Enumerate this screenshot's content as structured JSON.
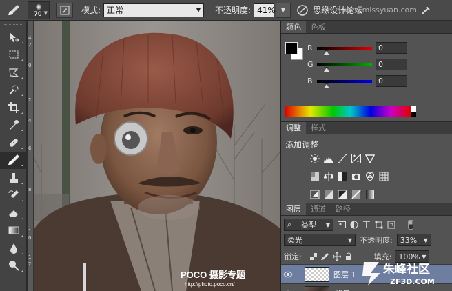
{
  "options_bar": {
    "brush_size": "70",
    "mode_label": "模式:",
    "mode_value": "正常",
    "opacity_label": "不透明度:",
    "opacity_value": "41%",
    "watermark_text": "思缘设计论坛",
    "watermark_url": "www.missyuan.com",
    "icons": [
      "brush-icon",
      "brush-panel-toggle-icon",
      "tablet-pressure-opacity-icon",
      "airbrush-icon"
    ]
  },
  "toolbar": {
    "tools": [
      {
        "name": "move",
        "icon": "move-icon"
      },
      {
        "name": "marquee",
        "icon": "rect-marquee-icon"
      },
      {
        "name": "lasso",
        "icon": "lasso-icon"
      },
      {
        "name": "quick-select",
        "icon": "quick-select-icon"
      },
      {
        "name": "crop",
        "icon": "crop-icon"
      },
      {
        "name": "eyedropper",
        "icon": "eyedropper-icon"
      },
      {
        "name": "healing",
        "icon": "healing-brush-icon"
      },
      {
        "name": "brush",
        "icon": "brush-icon",
        "active": true
      },
      {
        "name": "clone-stamp",
        "icon": "clone-stamp-icon"
      },
      {
        "name": "history-brush",
        "icon": "history-brush-icon"
      },
      {
        "name": "eraser",
        "icon": "eraser-icon"
      },
      {
        "name": "gradient",
        "icon": "gradient-icon"
      },
      {
        "name": "blur",
        "icon": "blur-icon"
      },
      {
        "name": "dodge",
        "icon": "dodge-icon"
      }
    ]
  },
  "ruler_marks": [
    "4",
    "2",
    "0",
    "2",
    "4",
    "6",
    "8",
    "1",
    "0",
    "1",
    "2"
  ],
  "canvas": {
    "watermark_brand": "POCO 摄影专题",
    "watermark_url": "http://photo.poco.cn/"
  },
  "color_panel": {
    "tabs": [
      "颜色",
      "色板"
    ],
    "active_tab": "颜色",
    "channels": [
      {
        "label": "R",
        "value": "0",
        "color": "#e00000"
      },
      {
        "label": "G",
        "value": "0",
        "color": "#00b000"
      },
      {
        "label": "B",
        "value": "0",
        "color": "#0000e0"
      }
    ],
    "foreground": "#000000",
    "background": "#ffffff"
  },
  "adjustments_panel": {
    "tabs": [
      "调整",
      "样式"
    ],
    "active_tab": "调整",
    "title": "添加调整",
    "rows": [
      [
        "brightness-contrast-icon",
        "levels-icon",
        "curves-icon",
        "exposure-icon",
        "vibrance-icon"
      ],
      [
        "hue-saturation-icon",
        "color-balance-icon",
        "black-white-icon",
        "photo-filter-icon",
        "channel-mixer-icon",
        "color-lookup-icon"
      ],
      [
        "invert-icon",
        "posterize-icon",
        "threshold-icon",
        "selective-color-icon",
        "gradient-map-icon"
      ]
    ]
  },
  "layers_panel": {
    "tabs": [
      "图层",
      "通道",
      "路径"
    ],
    "active_tab": "图层",
    "filter_kind": "类型",
    "blend_mode": "柔光",
    "opacity_label": "不透明度:",
    "opacity_value": "33%",
    "lock_label": "锁定:",
    "fill_label": "填充:",
    "fill_value": "100%",
    "layers": [
      {
        "name": "图层 1",
        "selected": true,
        "thumb": "checker"
      },
      {
        "name": "背景",
        "selected": false,
        "thumb": "photo"
      }
    ]
  },
  "site_logo": {
    "name": "朱峰社区",
    "url": "ZF3D.COM"
  }
}
